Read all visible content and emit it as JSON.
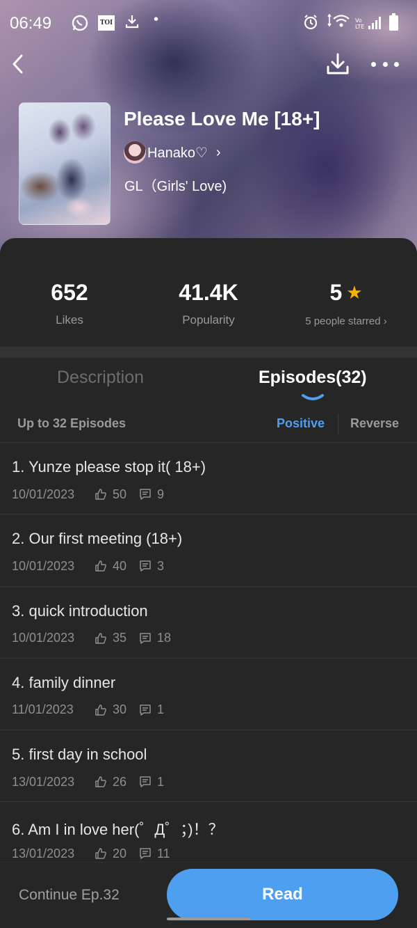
{
  "status_bar": {
    "time": "06:49",
    "dot": "•",
    "toi": "TOI",
    "icons": [
      "whatsapp-icon",
      "toi-icon",
      "download-icon",
      "alarm-icon",
      "wifi-icon",
      "volte-icon",
      "signal-icon",
      "battery-icon"
    ]
  },
  "header": {
    "title": "Please Love Me [18+]",
    "author": "Hanako♡",
    "author_chevron": "›",
    "genre": "GL（Girls' Love)"
  },
  "stats": {
    "likes_value": "652",
    "likes_label": "Likes",
    "popularity_value": "41.4K",
    "popularity_label": "Popularity",
    "rating_value": "5",
    "rating_label": "5 people starred ›",
    "star": "★"
  },
  "tabs": {
    "description": "Description",
    "episodes": "Episodes(32)"
  },
  "sort": {
    "count": "Up to 32 Episodes",
    "positive": "Positive",
    "reverse": "Reverse"
  },
  "episodes": [
    {
      "title": "1. Yunze please stop it( 18+)",
      "date": "10/01/2023",
      "likes": "50",
      "comments": "9"
    },
    {
      "title": "2. Our first meeting (18+)",
      "date": "10/01/2023",
      "likes": "40",
      "comments": "3"
    },
    {
      "title": "3. quick introduction",
      "date": "10/01/2023",
      "likes": "35",
      "comments": "18"
    },
    {
      "title": "4. family dinner",
      "date": "11/01/2023",
      "likes": "30",
      "comments": "1"
    },
    {
      "title": "5. first day in school",
      "date": "13/01/2023",
      "likes": "26",
      "comments": "1"
    },
    {
      "title": "6. Am I in love her(゜Д゜；)！？",
      "date": "13/01/2023",
      "likes": "20",
      "comments": "11"
    }
  ],
  "bottom": {
    "continue": "Continue Ep.32",
    "read": "Read"
  },
  "colors": {
    "accent": "#4f9ff0",
    "star": "#f5b301",
    "background": "#262626"
  }
}
